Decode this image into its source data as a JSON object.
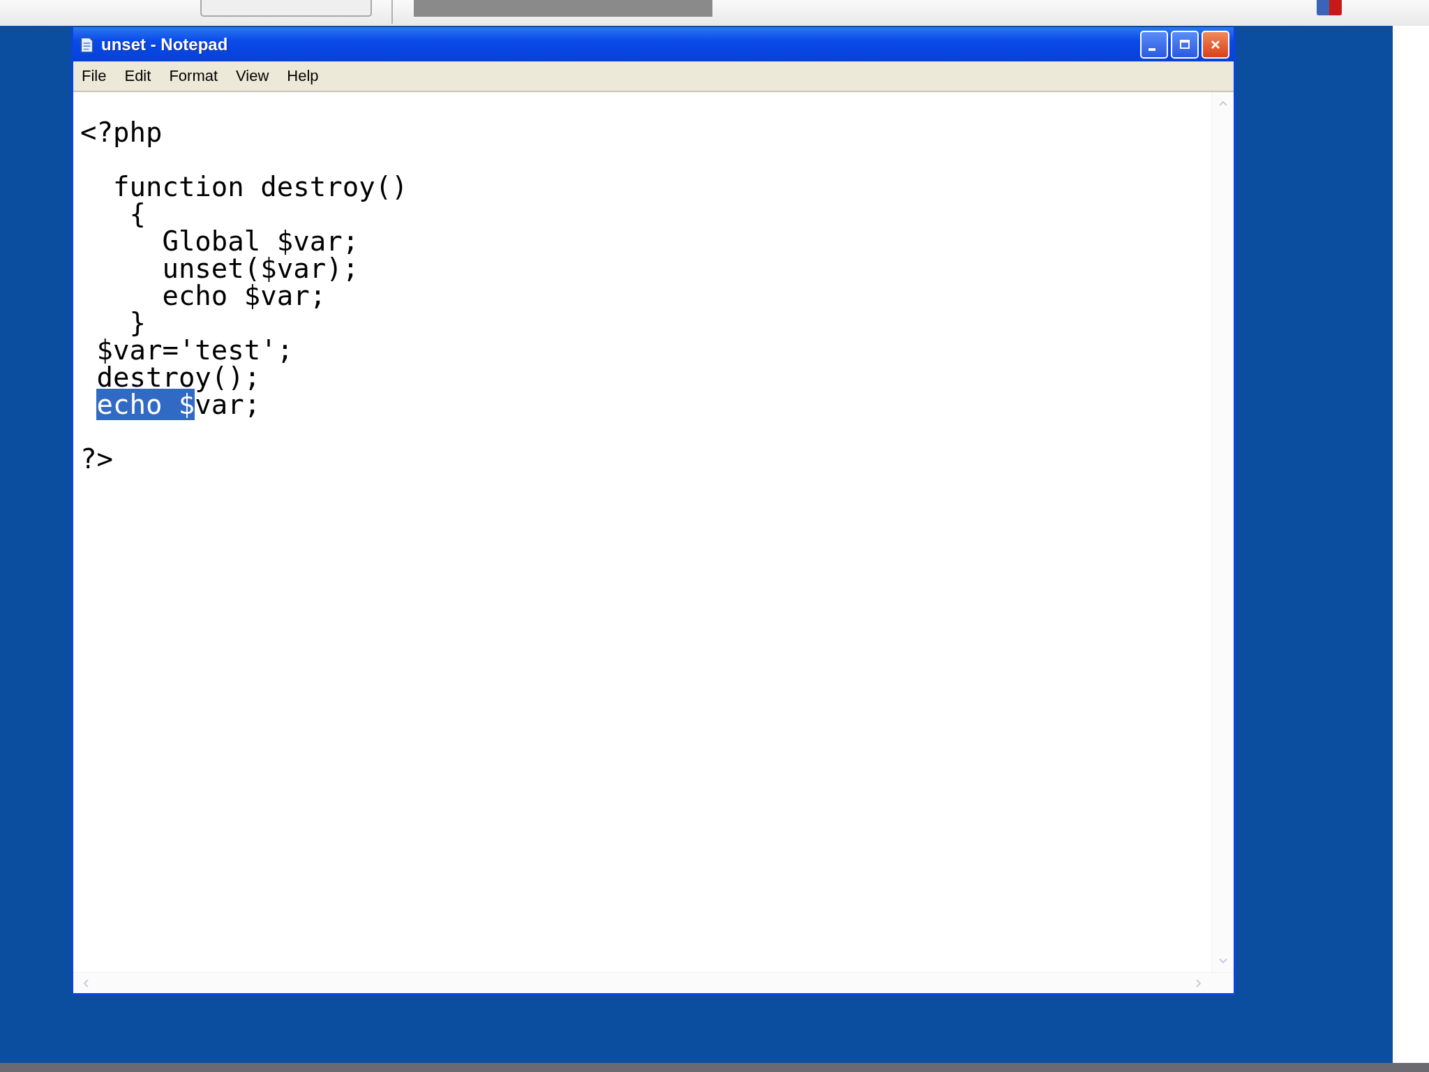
{
  "window": {
    "title": "unset - Notepad"
  },
  "menu": [
    {
      "label": "File"
    },
    {
      "label": "Edit"
    },
    {
      "label": "Format"
    },
    {
      "label": "View"
    },
    {
      "label": "Help"
    }
  ],
  "editor": {
    "lines": [
      {
        "kind": "code",
        "segments": [
          {
            "text": "<?php",
            "selected": false
          }
        ]
      },
      {
        "kind": "blank"
      },
      {
        "kind": "code",
        "segments": [
          {
            "text": "  function destroy()",
            "selected": false
          }
        ]
      },
      {
        "kind": "code",
        "segments": [
          {
            "text": "   {",
            "selected": false
          }
        ]
      },
      {
        "kind": "code",
        "segments": [
          {
            "text": "     Global $var;",
            "selected": false
          }
        ]
      },
      {
        "kind": "code",
        "segments": [
          {
            "text": "     unset($var);",
            "selected": false
          }
        ]
      },
      {
        "kind": "code",
        "segments": [
          {
            "text": "     echo $var;",
            "selected": false
          }
        ]
      },
      {
        "kind": "code",
        "segments": [
          {
            "text": "   }",
            "selected": false
          }
        ]
      },
      {
        "kind": "code",
        "segments": [
          {
            "text": " $var='test';",
            "selected": false
          }
        ]
      },
      {
        "kind": "code",
        "segments": [
          {
            "text": " destroy();",
            "selected": false
          }
        ]
      },
      {
        "kind": "code",
        "indented": true,
        "segments": [
          {
            "text": "echo $",
            "selected": true
          },
          {
            "text": "var;",
            "selected": false
          }
        ]
      },
      {
        "kind": "blank"
      },
      {
        "kind": "code",
        "segments": [
          {
            "text": "?>",
            "selected": false
          }
        ]
      }
    ]
  }
}
